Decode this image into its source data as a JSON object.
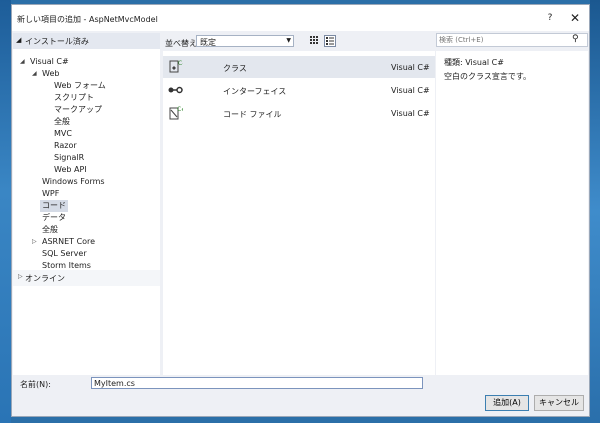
{
  "window": {
    "title": "新しい項目の追加 - AspNetMvcModel",
    "help": "?",
    "close": "✕"
  },
  "left_pane": {
    "header": "インストール済み",
    "tree": [
      {
        "label": "Visual C#",
        "expander": "◢"
      },
      {
        "label": "Web",
        "expander": "◢"
      },
      {
        "label": "Web フォーム"
      },
      {
        "label": "スクリプト"
      },
      {
        "label": "マークアップ"
      },
      {
        "label": "全般"
      },
      {
        "label": "MVC"
      },
      {
        "label": "Razor"
      },
      {
        "label": "SignalR"
      },
      {
        "label": "Web API"
      },
      {
        "label": "Windows Forms"
      },
      {
        "label": "WPF"
      },
      {
        "label": "コード",
        "selected": true
      },
      {
        "label": "データ"
      },
      {
        "label": "全般"
      },
      {
        "label": "ASRNET Core",
        "expander": "▷"
      },
      {
        "label": "SQL Server"
      },
      {
        "label": "Storm Items"
      }
    ],
    "online": {
      "label": "オンライン",
      "expander": "▷"
    }
  },
  "toolbar": {
    "sort_label": "並べ替え:",
    "sort_value": "既定"
  },
  "templates": [
    {
      "name": "クラス",
      "lang": "Visual C#",
      "icon": "class-icon",
      "selected": true
    },
    {
      "name": "インターフェイス",
      "lang": "Visual C#",
      "icon": "interface-icon"
    },
    {
      "name": "コード ファイル",
      "lang": "Visual C#",
      "icon": "code-file-icon"
    }
  ],
  "search": {
    "placeholder": "検索 (Ctrl+E)"
  },
  "details": {
    "type": "種類:  Visual C#",
    "description": "空白のクラス宣言です。"
  },
  "name_field": {
    "label": "名前(N):",
    "value": "MyItem.cs"
  },
  "buttons": {
    "add": "追加(A)",
    "cancel": "キャンセル"
  },
  "colors": {
    "selection": "#d5dbe6",
    "dialog_bg": "#eef0f5",
    "accent": "#3c7fb1",
    "icon_green": "#388a34"
  }
}
